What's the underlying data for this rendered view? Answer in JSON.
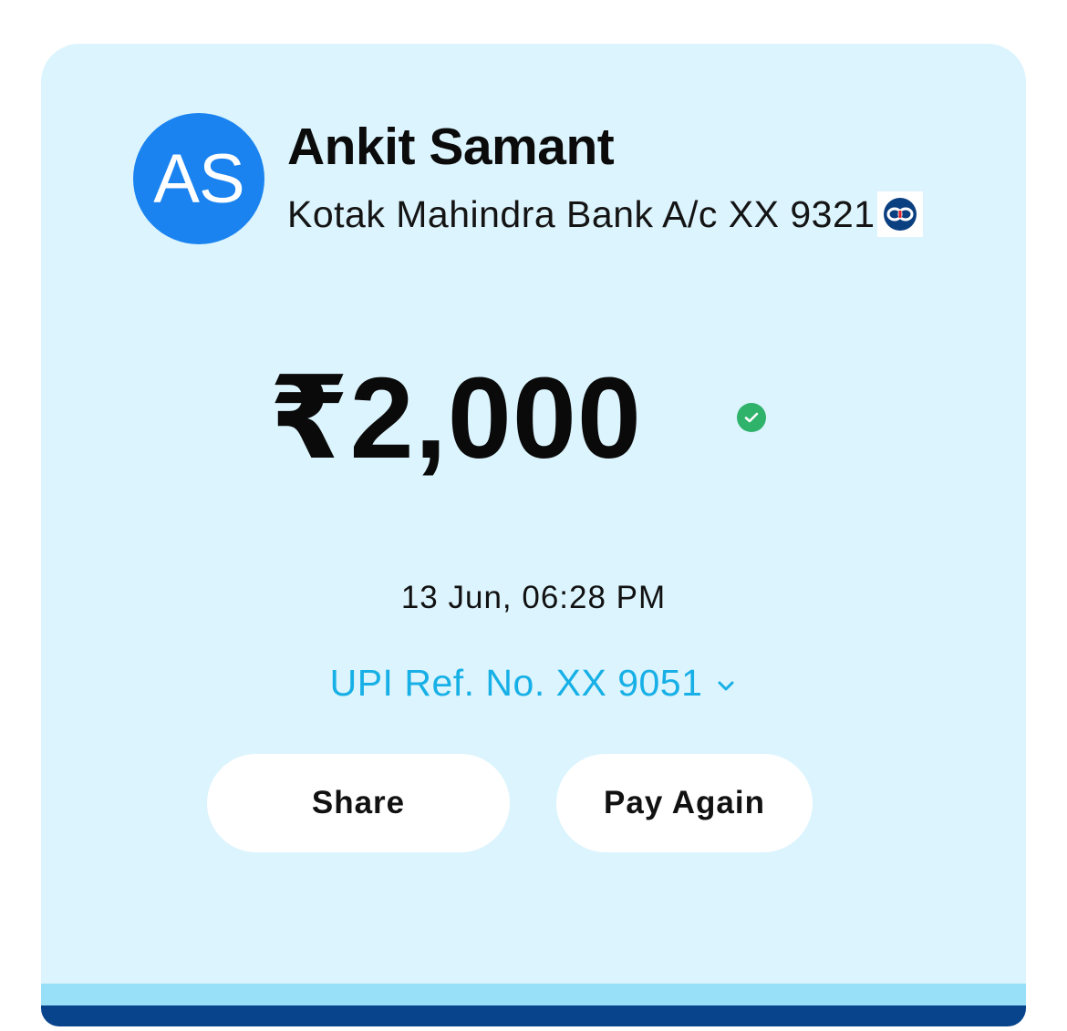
{
  "payee": {
    "initials": "AS",
    "name": "Ankit Samant",
    "bank_account": "Kotak Mahindra Bank A/c XX 9321",
    "bank_logo_icon": "kotak-bank-logo-icon"
  },
  "transaction": {
    "amount": "₹2,000",
    "status_icon": "success-check-icon",
    "datetime": "13 Jun, 06:28 PM",
    "upi_ref": "UPI Ref. No. XX 9051"
  },
  "actions": {
    "share_label": "Share",
    "pay_again_label": "Pay Again"
  },
  "colors": {
    "card_background": "#dcf4fd",
    "avatar": "#1a83f0",
    "link": "#17b0e6",
    "success": "#2fb26a",
    "band_light": "#97e0f8",
    "band_dark": "#07448c"
  }
}
